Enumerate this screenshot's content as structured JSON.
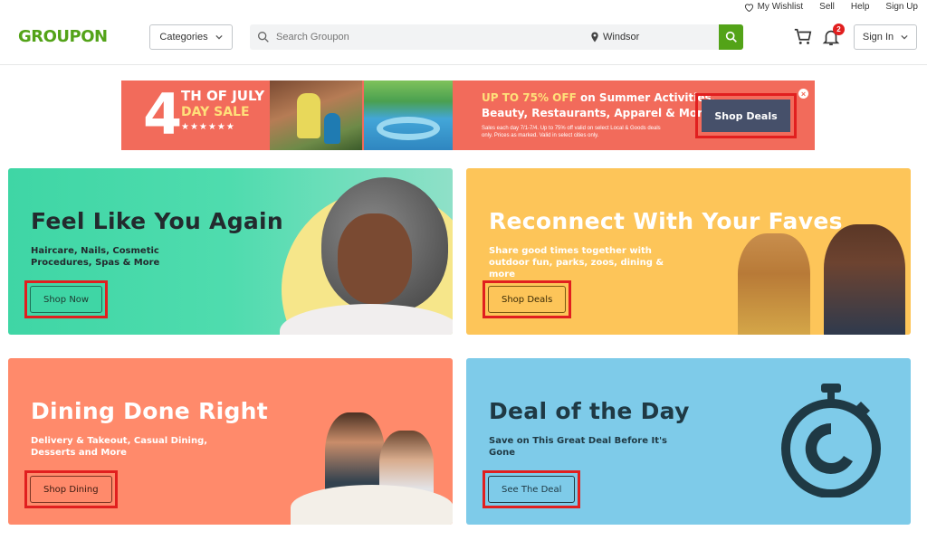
{
  "util": {
    "wishlist": "My Wishlist",
    "sell": "Sell",
    "help": "Help",
    "signup": "Sign Up"
  },
  "header": {
    "logo": "GROUPON",
    "categories": "Categories",
    "search_placeholder": "Search Groupon",
    "location": "Windsor",
    "notifications_count": "2",
    "signin": "Sign In"
  },
  "promo": {
    "big_number": "4",
    "line1": "TH OF JULY",
    "line2": "DAY SALE",
    "stars": "★★★★★★",
    "headline_highlight": "UP TO 75% OFF",
    "headline_rest": " on Summer Activities,",
    "headline2": "Beauty, Restaurants, Apparel & More",
    "fine_print": "Sales each day 7/1-7/4. Up to 75% off valid on select Local & Goods deals only. Prices as marked. Valid in select cities only.",
    "cta": "Shop Deals"
  },
  "cards": [
    {
      "title": "Feel Like You Again",
      "subtitle": "Haircare, Nails, Cosmetic Procedures, Spas & More",
      "cta": "Shop Now"
    },
    {
      "title": "Reconnect With Your Faves",
      "subtitle": "Share good times together with outdoor fun, parks, zoos, dining & more",
      "cta": "Shop Deals"
    },
    {
      "title": "Dining Done Right",
      "subtitle": "Delivery & Takeout, Casual Dining, Desserts and More",
      "cta": "Shop Dining"
    },
    {
      "title": "Deal of the Day",
      "subtitle": "Save on This Great Deal Before It's Gone",
      "cta": "See The Deal"
    }
  ],
  "colors": {
    "brand": "#53a318",
    "promo_bg": "#f26b5b",
    "highlight_red": "#e11f1f",
    "card_teal": "#3fd6a5",
    "card_yellow": "#fdc559",
    "card_coral": "#ff8a6b",
    "card_blue": "#7ecbe9"
  }
}
